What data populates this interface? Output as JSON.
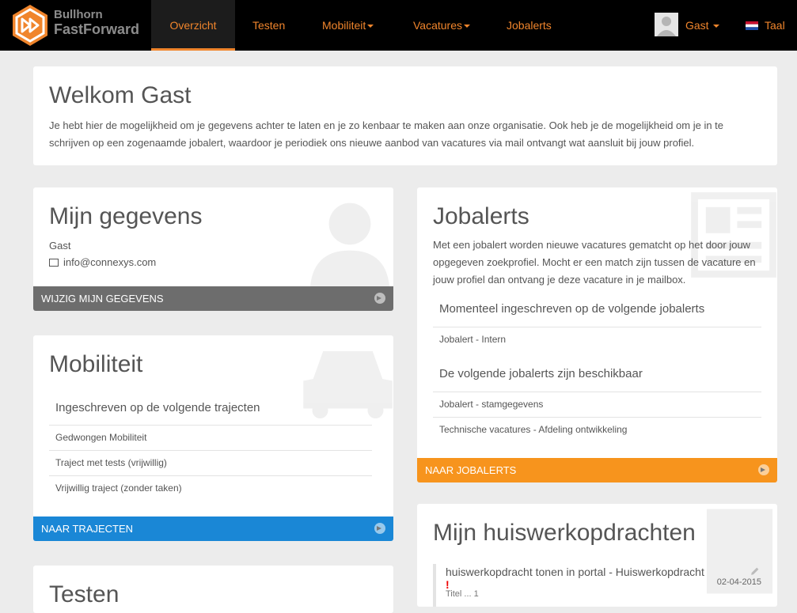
{
  "nav": {
    "brand_line1": "Bullhorn",
    "brand_line2": "FastForward",
    "items": [
      {
        "label": "Overzicht",
        "active": true,
        "dropdown": false
      },
      {
        "label": "Testen",
        "active": false,
        "dropdown": false
      },
      {
        "label": "Mobiliteit",
        "active": false,
        "dropdown": true
      },
      {
        "label": "Vacatures",
        "active": false,
        "dropdown": true
      },
      {
        "label": "Jobalerts",
        "active": false,
        "dropdown": false
      }
    ],
    "user": "Gast",
    "language": "Taal",
    "accent_color": "#f0852c"
  },
  "welcome": {
    "title": "Welkom Gast",
    "text": "Je hebt hier de mogelijkheid om je gegevens achter te laten en je zo kenbaar te maken aan onze organisatie. Ook heb je de mogelijkheid om je in te schrijven op een zogenaamde jobalert, waardoor je periodiek ons nieuwe aanbod van vacatures via mail ontvangt wat aansluit bij jouw profiel."
  },
  "gegevens": {
    "title": "Mijn gegevens",
    "name": "Gast",
    "email": "info@connexys.com",
    "action": "Wijzig mijn gegevens",
    "action_color": "#6d6d6d"
  },
  "mobiliteit": {
    "title": "Mobiliteit",
    "subtitle": "Ingeschreven op de volgende trajecten",
    "items": [
      "Gedwongen Mobiliteit",
      "Traject met tests (vrijwillig)",
      "Vrijwillig traject (zonder taken)"
    ],
    "action": "Naar trajecten",
    "action_color": "#1a87d6"
  },
  "testen": {
    "title": "Testen"
  },
  "jobalerts": {
    "title": "Jobalerts",
    "text": "Met een jobalert worden nieuwe vacatures gematcht op het door jouw opgegeven zoekprofiel. Mocht er een match zijn tussen de vacature en jouw profiel dan ontvang je deze vacature in je mailbox.",
    "subscribed_title": "Momenteel ingeschreven op de volgende jobalerts",
    "subscribed": [
      "Jobalert - Intern"
    ],
    "available_title": "De volgende jobalerts zijn beschikbaar",
    "available": [
      "Jobalert - stamgegevens",
      "Technische vacatures - Afdeling ontwikkeling"
    ],
    "action": "Naar jobalerts",
    "action_color": "#f7941d"
  },
  "huiswerk": {
    "title": "Mijn huiswerkopdrachten",
    "item_title": "huiswerkopdracht tonen in portal - Huiswerkopdracht",
    "item_date": "02-04-2015",
    "item_flag": "!",
    "item_sub": "Titel ... 1"
  }
}
